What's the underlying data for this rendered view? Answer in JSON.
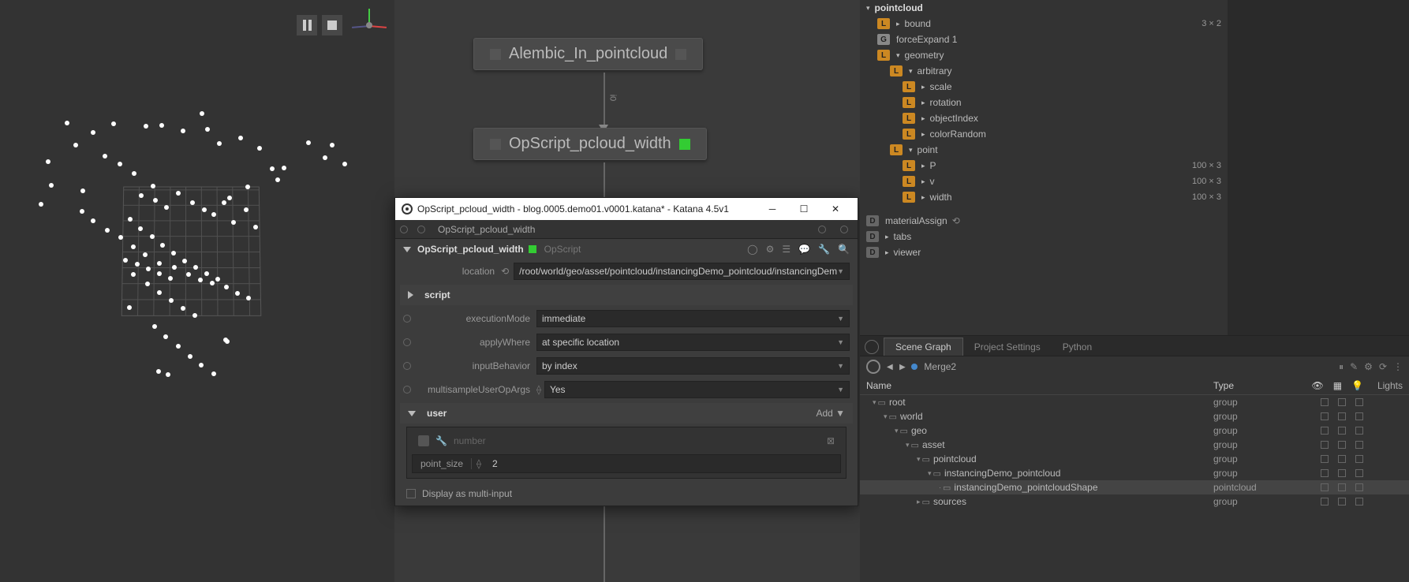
{
  "viewport": {
    "controls": [
      "pause",
      "stop"
    ]
  },
  "nodegraph": {
    "nodes": [
      {
        "label": "Alembic_In_pointcloud",
        "active": false
      },
      {
        "label": "OpScript_pcloud_width",
        "active": true
      }
    ],
    "connection_label": "i0"
  },
  "popup": {
    "title": "OpScript_pcloud_width - blog.0005.demo01.v0001.katana* - Katana 4.5v1",
    "tab": "OpScript_pcloud_width",
    "node_name": "OpScript_pcloud_width",
    "node_type": "OpScript",
    "params": {
      "location_label": "location",
      "location": "/root/world/geo/asset/pointcloud/instancingDemo_pointcloud/instancingDem",
      "script_section": "script",
      "executionMode_label": "executionMode",
      "executionMode": "immediate",
      "applyWhere_label": "applyWhere",
      "applyWhere": "at specific location",
      "inputBehavior_label": "inputBehavior",
      "inputBehavior": "by index",
      "multisample_label": "multisampleUserOpArgs",
      "multisample": "Yes",
      "user_section": "user",
      "add_label": "Add ▼",
      "user_hint": "number",
      "point_size_label": "point_size",
      "point_size_value": "2",
      "display_multi": "Display as multi-input"
    }
  },
  "attrs": {
    "root": "pointcloud",
    "rows": [
      {
        "lvl": 1,
        "badge": "L",
        "tri": "▸",
        "name": "bound",
        "val": "3 × 2"
      },
      {
        "lvl": 1,
        "badge": "G",
        "tri": "",
        "name": "forceExpand  1",
        "val": ""
      },
      {
        "lvl": 1,
        "badge": "L",
        "tri": "▾",
        "name": "geometry",
        "val": ""
      },
      {
        "lvl": 2,
        "badge": "L",
        "tri": "▾",
        "name": "arbitrary",
        "val": ""
      },
      {
        "lvl": 3,
        "badge": "L",
        "tri": "▸",
        "name": "scale",
        "val": ""
      },
      {
        "lvl": 3,
        "badge": "L",
        "tri": "▸",
        "name": "rotation",
        "val": ""
      },
      {
        "lvl": 3,
        "badge": "L",
        "tri": "▸",
        "name": "objectIndex",
        "val": ""
      },
      {
        "lvl": 3,
        "badge": "L",
        "tri": "▸",
        "name": "colorRandom",
        "val": ""
      },
      {
        "lvl": 2,
        "badge": "L",
        "tri": "▾",
        "name": "point",
        "val": ""
      },
      {
        "lvl": 3,
        "badge": "L",
        "tri": "▸",
        "name": "P",
        "val": "100 × 3"
      },
      {
        "lvl": 3,
        "badge": "L",
        "tri": "▸",
        "name": "v",
        "val": "100 × 3"
      },
      {
        "lvl": 3,
        "badge": "L",
        "tri": "▸",
        "name": "width",
        "val": "100 × 3"
      }
    ],
    "footer": [
      {
        "badge": "D",
        "name": "materialAssign",
        "icon": "⟲"
      },
      {
        "badge": "D",
        "tri": "▸",
        "name": "tabs"
      },
      {
        "badge": "D",
        "tri": "▸",
        "name": "viewer"
      }
    ]
  },
  "scenegraph": {
    "tabs": [
      "Scene Graph",
      "Project Settings",
      "Python"
    ],
    "current_node": "Merge2",
    "header_name": "Name",
    "header_type": "Type",
    "header_lights": "Lights",
    "rows": [
      {
        "ind": 0,
        "exp": "▾",
        "name": "root",
        "type": "group"
      },
      {
        "ind": 1,
        "exp": "▾",
        "name": "world",
        "type": "group"
      },
      {
        "ind": 2,
        "exp": "▾",
        "name": "geo",
        "type": "group"
      },
      {
        "ind": 3,
        "exp": "▾",
        "name": "asset",
        "type": "group"
      },
      {
        "ind": 4,
        "exp": "▾",
        "name": "pointcloud",
        "type": "group"
      },
      {
        "ind": 5,
        "exp": "▾",
        "name": "instancingDemo_pointcloud",
        "type": "group"
      },
      {
        "ind": 6,
        "exp": "",
        "name": "instancingDemo_pointcloudShape",
        "type": "pointcloud",
        "sel": true
      },
      {
        "ind": 4,
        "exp": "▸",
        "name": "sources",
        "type": "group"
      }
    ]
  }
}
